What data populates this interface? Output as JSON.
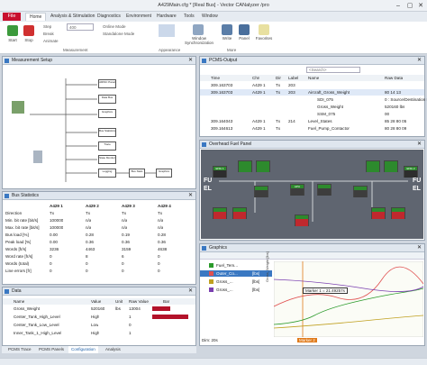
{
  "window": {
    "title": "A429Main.cfg * [Real Bus] - Vector CANalyzer /pro"
  },
  "menu": {
    "file": "File",
    "items": [
      "Home",
      "Analysis & Stimulation",
      "Diagnostics",
      "Environment",
      "Hardware",
      "Tools",
      "Window"
    ]
  },
  "ribbon": {
    "start": "Start",
    "stop": "Stop",
    "step": "Step",
    "break": "Break",
    "animate": "Animate",
    "speed_value": "400",
    "online_mode": "Online Mode",
    "standalone_mode": "Standalone Mode",
    "window_sync": "Window Synchronization",
    "write": "Write",
    "panel": "Panel",
    "favorites": "Favorites",
    "groups": {
      "measurement": "Measurement",
      "appearance": "Appearance",
      "more": "More"
    }
  },
  "measurement_setup": {
    "title": "Measurement Setup",
    "nodes": [
      "ARINC Panel",
      "Data Bus",
      "Graphics",
      "Bus Statistics",
      "Trace",
      "State Monitor",
      "Logging",
      "Bus Stats",
      "Graphics"
    ]
  },
  "bus_statistics": {
    "title": "Bus Statistics",
    "columns": [
      "",
      "A429 1",
      "A429 2",
      "A429 3",
      "A429 4"
    ],
    "rows": [
      [
        "Direction",
        "Tx",
        "Tx",
        "Tx",
        "Tx"
      ],
      [
        "Min. bit rate [bit/s]",
        "100000",
        "n/a",
        "n/a",
        "n/a"
      ],
      [
        "Max. bit rate [bit/s]",
        "100000",
        "n/a",
        "n/a",
        "n/a"
      ],
      [
        "Bus load [%]",
        "0.00",
        "0.28",
        "0.19",
        "0.28"
      ],
      [
        "Peak load [%]",
        "0.00",
        "0.36",
        "0.36",
        "0.36"
      ],
      [
        "Words [fr/s]",
        "3236",
        "4463",
        "3159",
        "4638"
      ],
      [
        "Word rate [fr/s]",
        "0",
        "8",
        "6",
        "0"
      ],
      [
        "Words (total)",
        "0",
        "0",
        "0",
        "0"
      ],
      [
        "Line errors [fr]",
        "0",
        "0",
        "0",
        "0"
      ]
    ]
  },
  "data": {
    "title": "Data",
    "columns": [
      "Name",
      "Value",
      "Unit",
      "Raw Value",
      "Bar"
    ],
    "rows": [
      {
        "name": "Gross_Weight",
        "value": "520160",
        "unit": "lbs",
        "raw": "13004",
        "bar": 0.45
      },
      {
        "name": "Center_Tank_High_Level",
        "value": "High",
        "unit": "",
        "raw": "1",
        "bar": 0.9
      },
      {
        "name": "Center_Tank_Low_Level",
        "value": "Low",
        "unit": "",
        "raw": "0",
        "bar": 0.0
      },
      {
        "name": "Inner_Tank_1_High_Level",
        "value": "High",
        "unit": "",
        "raw": "1",
        "bar": 0.0
      }
    ]
  },
  "bottom_tabs": [
    "PCMS Trace",
    "PCMS Panels",
    "Configuration",
    "Analysis"
  ],
  "trace": {
    "title": "PCMS-Output",
    "search_placeholder": "<Search>",
    "columns": [
      "Time",
      "Chn",
      "Dir",
      "Label",
      "Name",
      "Raw Data"
    ],
    "rows": [
      [
        "309.163703",
        "A429 1",
        "Tx",
        "203",
        "",
        ""
      ],
      [
        "309.163703",
        "A429 1",
        "Tx",
        "203",
        "Aircraft_Gross_Weight",
        "80 14 13"
      ],
      [
        "",
        "",
        "",
        "",
        "SDI_075",
        "0 : Source/Destination Identifier"
      ],
      [
        "",
        "",
        "",
        "",
        "Gross_Weight",
        "520160 lbs"
      ],
      [
        "",
        "",
        "",
        "",
        "SSM_075",
        "00"
      ],
      [
        "309.164043",
        "A429 1",
        "Tx",
        "214",
        "Level_States",
        "85 28 80 05"
      ],
      [
        "309.164613",
        "A429 1",
        "Tx",
        "",
        "Fuel_Pump_Contactor",
        "80 28 80 09"
      ]
    ]
  },
  "fuel_panel": {
    "title": "Overhead Fuel Panel",
    "left": "FUEL",
    "right": "FUEL",
    "eng1": "ENG 1",
    "eng2": "ENG 2",
    "apu": "APU"
  },
  "graphics": {
    "title": "Graphics",
    "signals": [
      {
        "name": "Fuel_Tem...",
        "unit": ""
      },
      {
        "name": "Outer_Co...",
        "unit": "[lbs]"
      },
      {
        "name": "Gross_...",
        "unit": "[lbs]"
      },
      {
        "name": "Gross_...",
        "unit": "[lbs]"
      }
    ],
    "marker_label": "Marker 1 = 21.49257s",
    "marker_tag": "Marker 2",
    "dim": "Dim: 20s",
    "yaxis": "Gross_Weight [lbs]",
    "colors": {
      "s1": "#2a9a2a",
      "s2": "#e05050",
      "s3": "#c0a020",
      "s4": "#7a3fb0"
    }
  }
}
